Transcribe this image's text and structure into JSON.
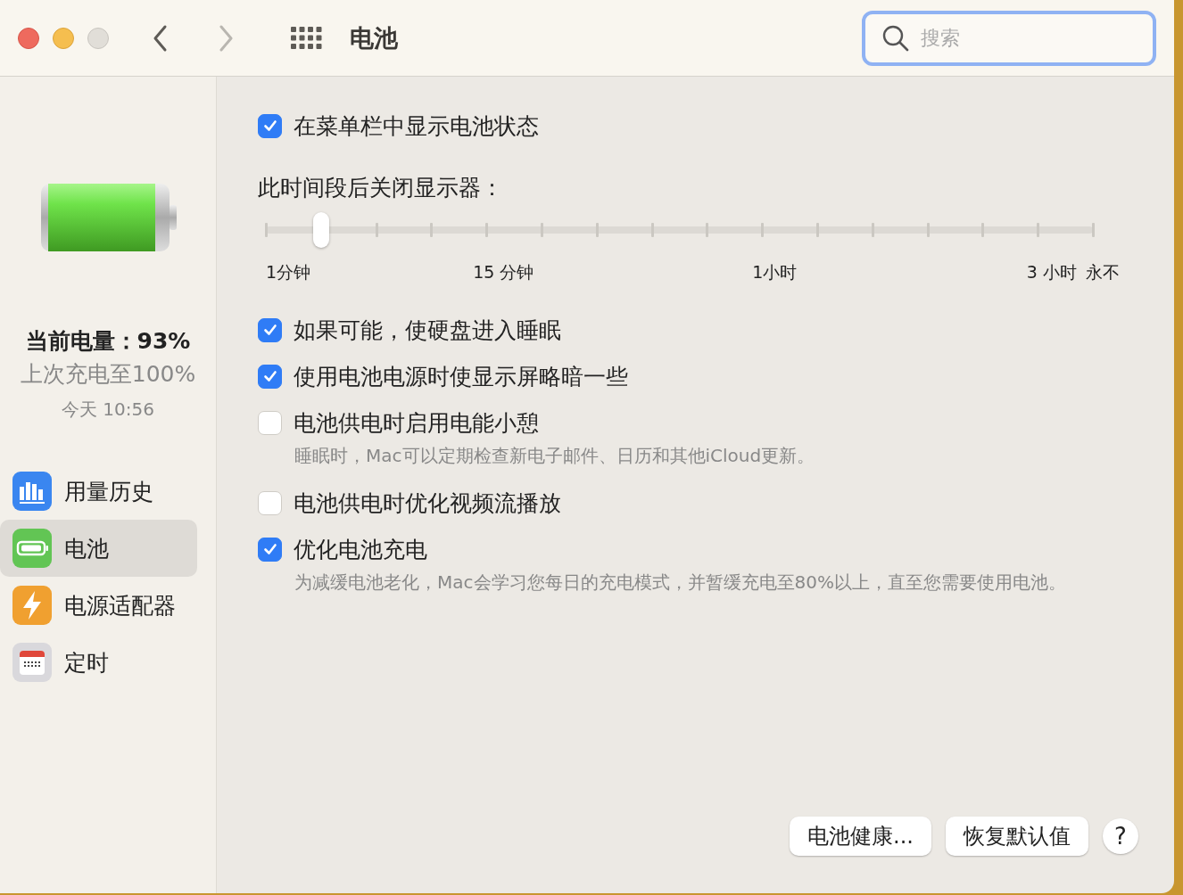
{
  "window": {
    "title": "电池"
  },
  "search": {
    "placeholder": "搜索"
  },
  "sidebar": {
    "status": [
      {
        "kind": "current",
        "text": "当前电量：93%"
      },
      {
        "kind": "last",
        "text": "上次充电至100%"
      },
      {
        "kind": "time",
        "text": "今天 10:56"
      }
    ],
    "items": [
      {
        "kind": "history",
        "label": "用量历史",
        "selected": false
      },
      {
        "kind": "battery",
        "label": "电池",
        "selected": true
      },
      {
        "kind": "adapter",
        "label": "电源适配器",
        "selected": false
      },
      {
        "kind": "schedule",
        "label": "定时",
        "selected": false
      }
    ]
  },
  "options_top": [
    {
      "label": "在菜单栏中显示电池状态",
      "checked": true
    }
  ],
  "display_off": {
    "label": "此时间段后关闭显示器：",
    "level": 0.0667,
    "ticks": [
      {
        "kind": "labeled",
        "label": "1分钟"
      },
      {
        "kind": "plain"
      },
      {
        "kind": "plain"
      },
      {
        "kind": "plain"
      },
      {
        "kind": "labeled",
        "label": "15 分钟"
      },
      {
        "kind": "plain"
      },
      {
        "kind": "plain"
      },
      {
        "kind": "plain"
      },
      {
        "kind": "plain"
      },
      {
        "kind": "labeled",
        "label": "1小时"
      },
      {
        "kind": "plain"
      },
      {
        "kind": "plain"
      },
      {
        "kind": "plain"
      },
      {
        "kind": "plain"
      },
      {
        "kind": "labeled",
        "label": "3 小时"
      },
      {
        "kind": "labeled",
        "label": "永不"
      }
    ]
  },
  "options": [
    {
      "label": "如果可能，使硬盘进入睡眠",
      "checked": true
    },
    {
      "label": "使用电池电源时使显示屏略暗一些",
      "checked": true
    },
    {
      "label": "电池供电时启用电能小憩",
      "checked": false,
      "note": "睡眠时，Mac可以定期检查新电子邮件、日历和其他iCloud更新。"
    },
    {
      "label": "电池供电时优化视频流播放",
      "checked": false
    },
    {
      "label": "优化电池充电",
      "checked": true,
      "note": "为减缓电池老化，Mac会学习您每日的充电模式，并暂缓充电至80%以上，直至您需要使用电池。"
    }
  ],
  "buttons": [
    {
      "kind": "text",
      "label": "电池健康..."
    },
    {
      "kind": "text",
      "label": "恢复默认值"
    },
    {
      "kind": "help",
      "label": "?"
    }
  ]
}
